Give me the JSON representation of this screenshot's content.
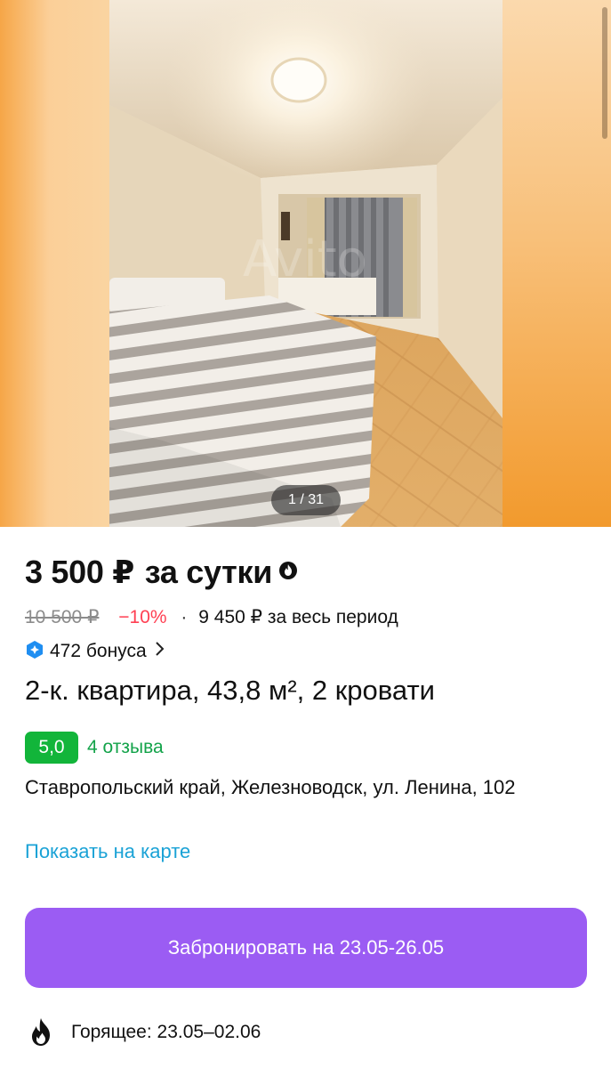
{
  "gallery": {
    "counter": "1 / 31",
    "watermark": "Avito"
  },
  "listing": {
    "price": "3 500 ₽",
    "price_suffix": "за сутки",
    "old_price": "10 500 ₽",
    "discount": "−10%",
    "period_total": "9 450 ₽ за весь период",
    "bonus": "472 бонуса",
    "title": "2-к. квартира, 43,8 м², 2 кровати",
    "rating": "5,0",
    "reviews": "4 отзыва",
    "address": "Ставропольский край, Железноводск, ул. Ленина, 102",
    "map_link": "Показать на карте",
    "book_button": "Забронировать на 23.05-26.05",
    "hot_offer": "Горящее: 23.05–02.06"
  },
  "colors": {
    "accent_purple": "#9b5cf3",
    "rating_green": "#12b53a",
    "discount_red": "#ff4053",
    "link_blue": "#1aa2d6"
  }
}
